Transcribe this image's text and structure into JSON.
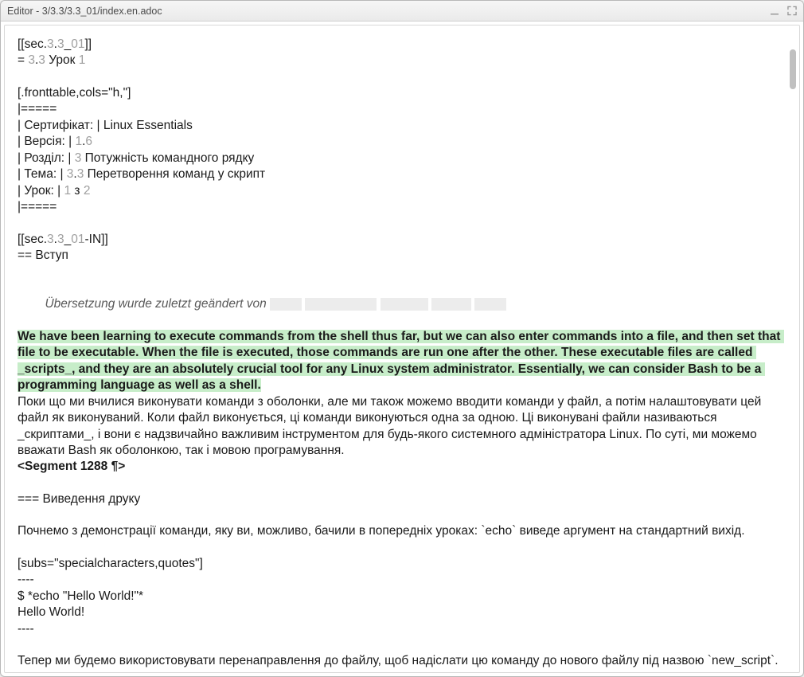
{
  "window": {
    "title": "Editor - 3/3.3/3.3_01/index.en.adoc"
  },
  "lines": {
    "l01a": "[[sec.",
    "l01b": "3",
    "l01c": ".",
    "l01d": "3",
    "l01e": "_",
    "l01f": "01",
    "l01g": "]]",
    "l02a": "= ",
    "l02b": "3",
    "l02c": ".",
    "l02d": "3",
    "l02e": " Урок ",
    "l02f": "1",
    "l03": "[.fronttable,cols=\"h,\"]",
    "l04": "|=====",
    "l05": "| Сертифікат: | Linux Essentials",
    "l06a": "| Версія: | ",
    "l06b": "1",
    "l06c": ".",
    "l06d": "6",
    "l07a": "| Розділ: | ",
    "l07b": "3",
    "l07c": " Потужність командного рядку",
    "l08a": "| Тема: | ",
    "l08b": "3",
    "l08c": ".",
    "l08d": "3",
    "l08e": " Перетворення команд у скрипт",
    "l09a": "| Урок: | ",
    "l09b": "1",
    "l09c": " з ",
    "l09d": "2",
    "l10": "|=====",
    "l11a": "[[sec.",
    "l11b": "3",
    "l11c": ".",
    "l11d": "3",
    "l11e": "_",
    "l11f": "01",
    "l11g": "-IN]]",
    "l12": "== Вступ",
    "meta": "Übersetzung wurde zuletzt geändert von ",
    "hl": "We have been learning to execute commands from the shell thus far, but we can also enter commands into a file, and then set that file to be executable. When the file is executed, those commands are run one after the other. These executable files are called _scripts_, and they are an absolutely crucial tool for any Linux system administrator. Essentially, we can consider Bash to be a programming language as well as a shell.",
    "tr": "Поки що ми вчилися виконувати команди з оболонки, але ми також можемо вводити команди у файл, а потім налаштовувати цей файл як виконуваний. Коли файл виконується, ці команди виконуються одна за одною. Ці виконувані файли називаються _скриптами_, і вони є надзвичайно важливим інструментом для будь-якого системного адміністратора Linux. По суті, ми можемо вважати Bash як оболонкою, так і мовою програмування.",
    "seg": "<Segment 1288 ¶>",
    "l13": "=== Виведення друку",
    "l14": "Почнемо з демонстрації команди, яку ви, можливо, бачили в попередніх уроках: `echo` виведе аргумент на стандартний вихід.",
    "l15": "[subs=\"specialcharacters,quotes\"]",
    "l16": "----",
    "l17": "$ *echo \"Hello World!\"*",
    "l18": "Hello World!",
    "l19": "----",
    "l20": "Тепер ми будемо використовувати перенаправлення до файлу, щоб надіслати цю команду до нового файлу під назвою `new_script`."
  }
}
